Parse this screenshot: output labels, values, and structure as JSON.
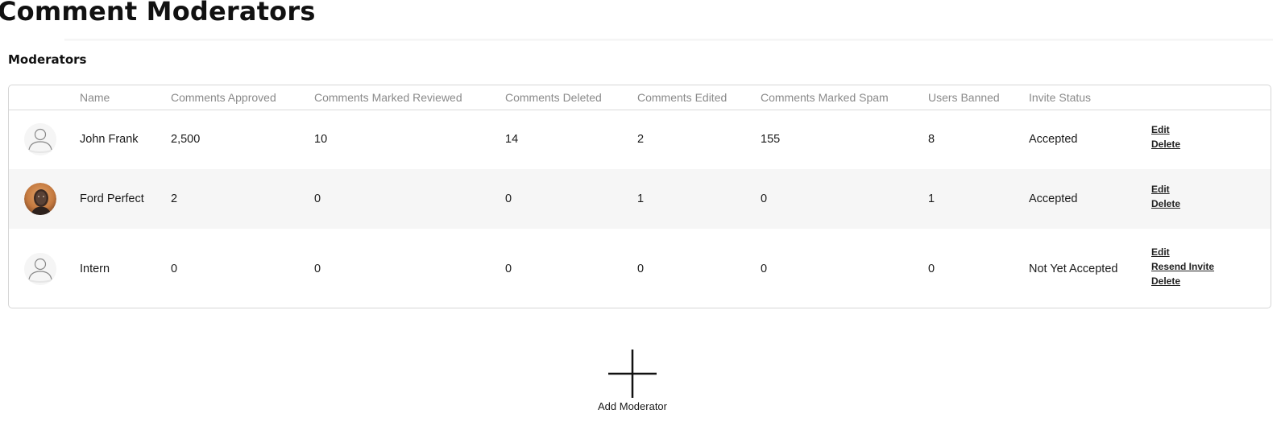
{
  "page": {
    "title": "Comment Moderators"
  },
  "section": {
    "title": "Moderators"
  },
  "table": {
    "columns": [
      "",
      "Name",
      "Comments Approved",
      "Comments Marked Reviewed",
      "Comments Deleted",
      "Comments Edited",
      "Comments Marked Spam",
      "Users Banned",
      "Invite Status",
      ""
    ],
    "rows": [
      {
        "avatar": "default-user-icon",
        "name": "John Frank",
        "approved": "2,500",
        "reviewed": "10",
        "deleted": "14",
        "edited": "2",
        "spam": "155",
        "banned": "8",
        "status": "Accepted",
        "actions": [
          "Edit",
          "Delete"
        ]
      },
      {
        "avatar": "user-photo",
        "name": "Ford Perfect",
        "approved": "2",
        "reviewed": "0",
        "deleted": "0",
        "edited": "1",
        "spam": "0",
        "banned": "1",
        "status": "Accepted",
        "actions": [
          "Edit",
          "Delete"
        ]
      },
      {
        "avatar": "default-user-icon",
        "name": "Intern",
        "approved": "0",
        "reviewed": "0",
        "deleted": "0",
        "edited": "0",
        "spam": "0",
        "banned": "0",
        "status": "Not Yet Accepted",
        "actions": [
          "Edit",
          "Resend Invite",
          "Delete"
        ]
      }
    ]
  },
  "add_button": {
    "label": "Add Moderator",
    "icon": "plus-icon"
  }
}
